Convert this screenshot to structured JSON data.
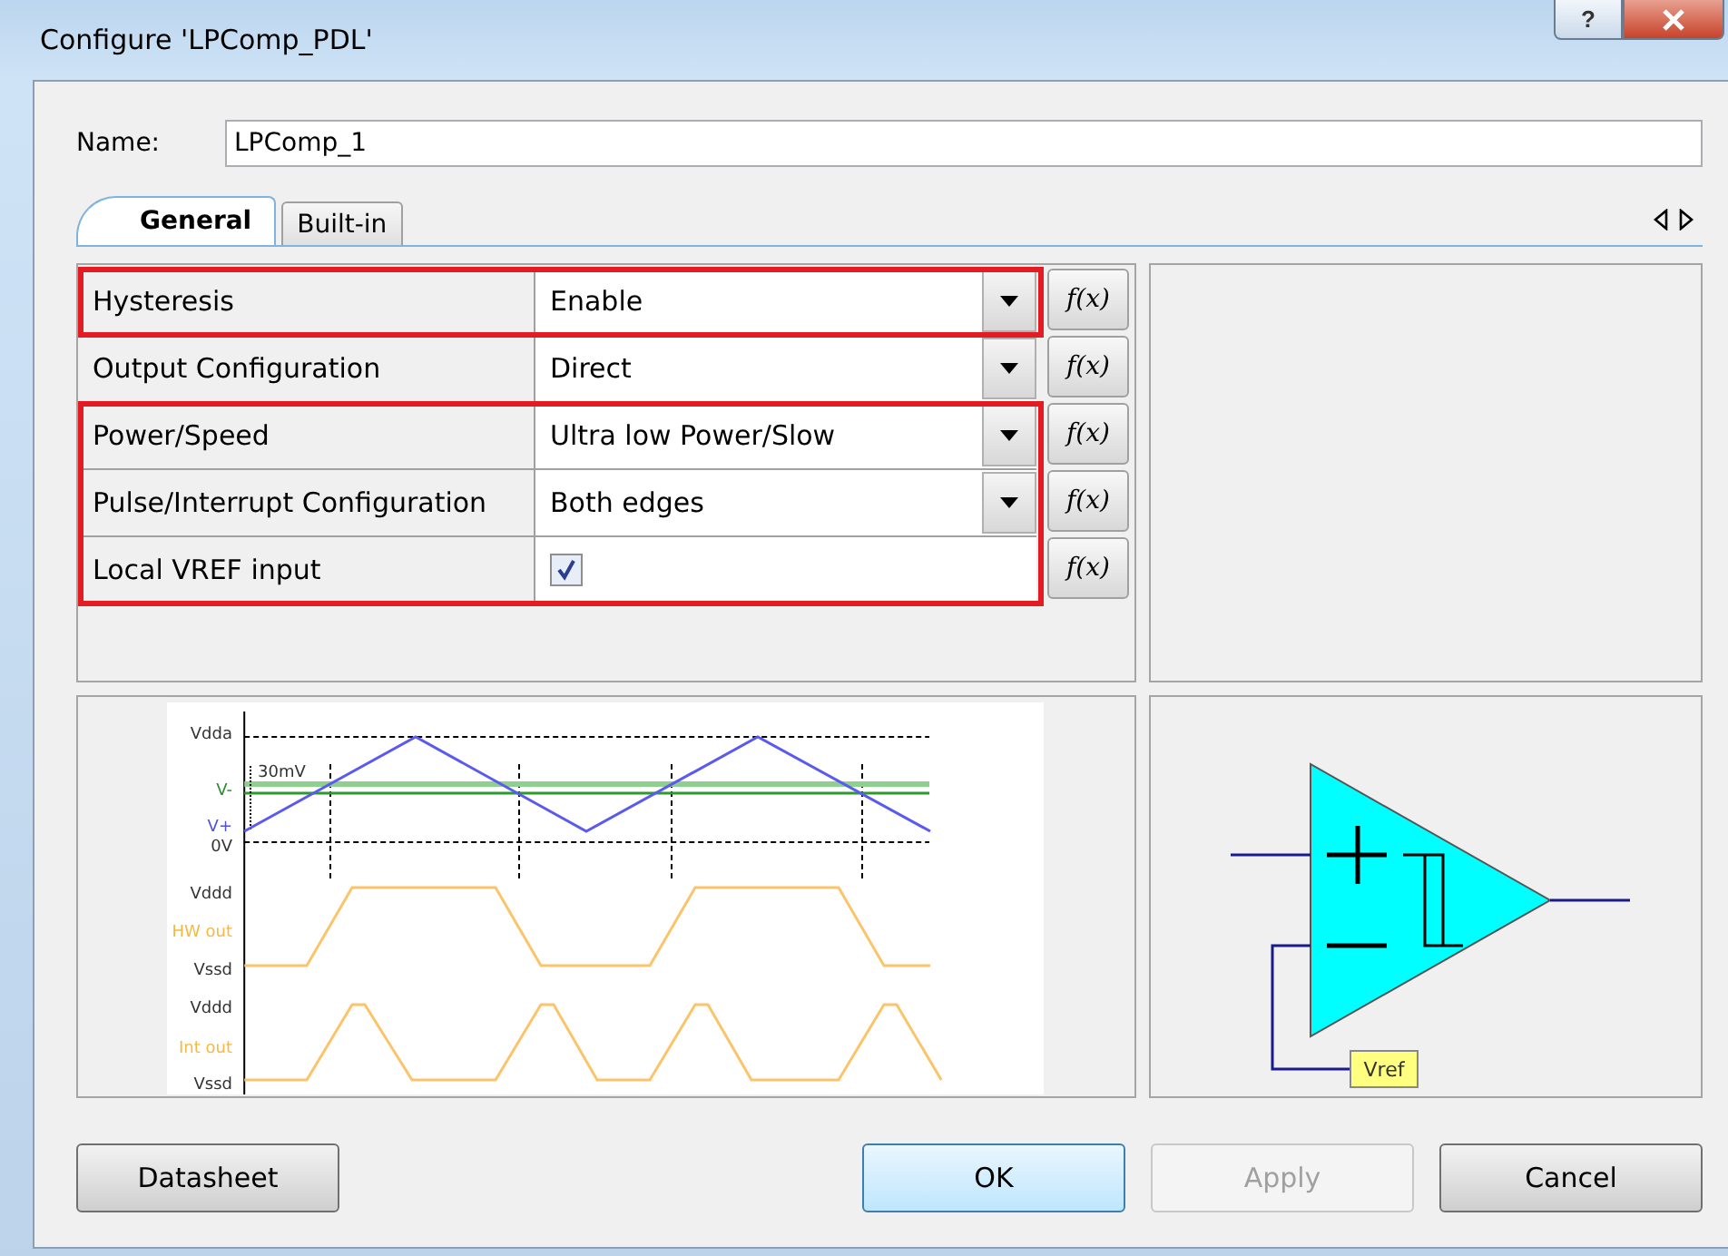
{
  "window": {
    "title": "Configure 'LPComp_PDL'",
    "help_button": "?"
  },
  "name_field": {
    "label": "Name:",
    "value": "LPComp_1"
  },
  "tabs": [
    {
      "label": "General",
      "selected": true
    },
    {
      "label": "Built-in",
      "selected": false
    }
  ],
  "parameters": [
    {
      "kind": "dropdown",
      "label": "Hysteresis",
      "value": "Enable",
      "highlighted": true,
      "formula": "f(x)"
    },
    {
      "kind": "dropdown",
      "label": "Output Configuration",
      "value": "Direct",
      "highlighted": false,
      "formula": "f(x)"
    },
    {
      "kind": "dropdown",
      "label": "Power/Speed",
      "value": "Ultra low Power/Slow",
      "highlighted": true,
      "formula": "f(x)"
    },
    {
      "kind": "dropdown",
      "label": "Pulse/Interrupt Configuration",
      "value": "Both edges",
      "highlighted": true,
      "formula": "f(x)"
    },
    {
      "kind": "checkbox",
      "label": "Local VREF input",
      "checked": true,
      "highlighted": true,
      "formula": "f(x)"
    }
  ],
  "waveform": {
    "labels": [
      {
        "text": "Vdda",
        "color": "#333333"
      },
      {
        "text": "30mV",
        "color": "#333333"
      },
      {
        "text": "V-",
        "color": "#2e8b2e"
      },
      {
        "text": "V+",
        "color": "#5050e0"
      },
      {
        "text": "0V",
        "color": "#333333"
      },
      {
        "text": "Vddd",
        "color": "#333333"
      },
      {
        "text": "HW out",
        "color": "#f5b942"
      },
      {
        "text": "Vssd",
        "color": "#333333"
      },
      {
        "text": "Vddd",
        "color": "#333333"
      },
      {
        "text": "Int out",
        "color": "#f5b942"
      },
      {
        "text": "Vssd",
        "color": "#333333"
      }
    ]
  },
  "symbol": {
    "vref_label": "Vref"
  },
  "buttons": [
    {
      "label": "Datasheet",
      "disabled": false,
      "default": false
    },
    {
      "label": "OK",
      "disabled": false,
      "default": true
    },
    {
      "label": "Apply",
      "disabled": true,
      "default": false
    },
    {
      "label": "Cancel",
      "disabled": false,
      "default": false
    }
  ]
}
